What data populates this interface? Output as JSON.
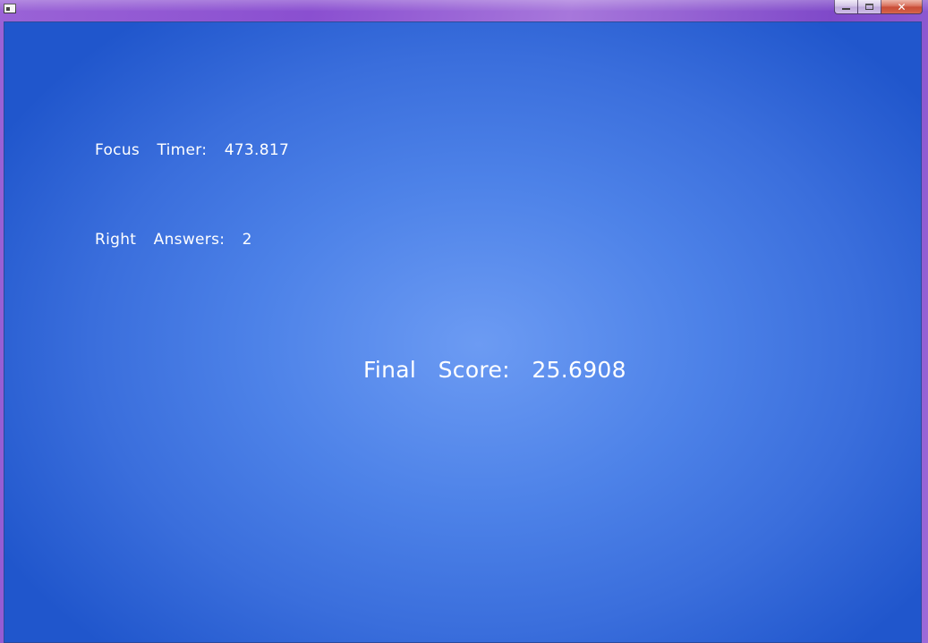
{
  "window": {
    "controls": {
      "minimize": "",
      "maximize": "",
      "close": "✕"
    }
  },
  "stats": {
    "focus_timer": "Focus  Timer:  473.817",
    "right_answers": "Right  Answers:  2",
    "final_score": "Final  Score:  25.6908"
  },
  "colors": {
    "background_center": "#6c9bf3",
    "background_edge": "#2056cc",
    "text": "#ffffff",
    "titlebar": "#9a63d6"
  }
}
